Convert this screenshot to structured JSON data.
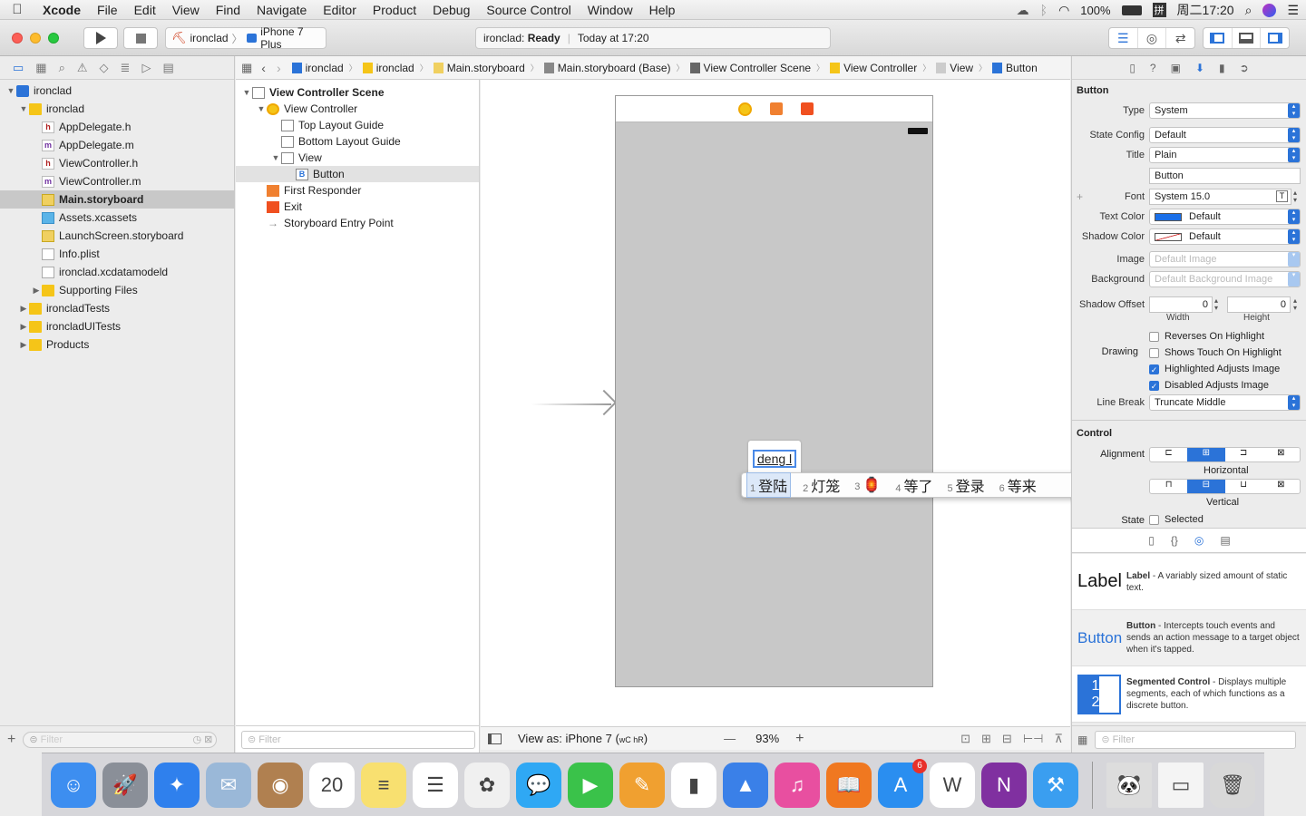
{
  "menubar": {
    "app": "Xcode",
    "items": [
      "File",
      "Edit",
      "View",
      "Find",
      "Navigate",
      "Editor",
      "Product",
      "Debug",
      "Source Control",
      "Window",
      "Help"
    ],
    "battery": "100%",
    "clock": "周二17:20"
  },
  "toolbar": {
    "scheme": "ironclad",
    "device": "iPhone 7 Plus",
    "status_project": "ironclad:",
    "status_state": "Ready",
    "status_time": "Today at 17:20"
  },
  "navigator": {
    "filter_placeholder": "Filter",
    "tree": [
      {
        "label": "ironclad",
        "depth": 0,
        "icon": "project-icon",
        "disclosure": "open"
      },
      {
        "label": "ironclad",
        "depth": 1,
        "icon": "folder-icon",
        "disclosure": "open"
      },
      {
        "label": "AppDelegate.h",
        "depth": 2,
        "icon": "header-file-icon",
        "disclosure": ""
      },
      {
        "label": "AppDelegate.m",
        "depth": 2,
        "icon": "implementation-file-icon",
        "disclosure": ""
      },
      {
        "label": "ViewController.h",
        "depth": 2,
        "icon": "header-file-icon",
        "disclosure": ""
      },
      {
        "label": "ViewController.m",
        "depth": 2,
        "icon": "implementation-file-icon",
        "disclosure": ""
      },
      {
        "label": "Main.storyboard",
        "depth": 2,
        "icon": "storyboard-file-icon",
        "disclosure": "",
        "selected": true
      },
      {
        "label": "Assets.xcassets",
        "depth": 2,
        "icon": "asset-catalog-icon",
        "disclosure": ""
      },
      {
        "label": "LaunchScreen.storyboard",
        "depth": 2,
        "icon": "storyboard-file-icon",
        "disclosure": ""
      },
      {
        "label": "Info.plist",
        "depth": 2,
        "icon": "plist-file-icon",
        "disclosure": ""
      },
      {
        "label": "ironclad.xcdatamodeld",
        "depth": 2,
        "icon": "datamodel-file-icon",
        "disclosure": ""
      },
      {
        "label": "Supporting Files",
        "depth": 2,
        "icon": "folder-icon",
        "disclosure": "closed"
      },
      {
        "label": "ironcladTests",
        "depth": 1,
        "icon": "folder-icon",
        "disclosure": "closed"
      },
      {
        "label": "ironcladUITests",
        "depth": 1,
        "icon": "folder-icon",
        "disclosure": "closed"
      },
      {
        "label": "Products",
        "depth": 1,
        "icon": "folder-icon",
        "disclosure": "closed"
      }
    ]
  },
  "jumpbar": {
    "crumbs": [
      "ironclad",
      "ironclad",
      "Main.storyboard",
      "Main.storyboard (Base)",
      "View Controller Scene",
      "View Controller",
      "View",
      "Button"
    ]
  },
  "outline": {
    "filter_placeholder": "Filter",
    "rows": [
      {
        "label": "View Controller Scene",
        "depth": 0,
        "disclosure": "open",
        "bold": true
      },
      {
        "label": "View Controller",
        "depth": 1,
        "disclosure": "open"
      },
      {
        "label": "Top Layout Guide",
        "depth": 2,
        "disclosure": ""
      },
      {
        "label": "Bottom Layout Guide",
        "depth": 2,
        "disclosure": ""
      },
      {
        "label": "View",
        "depth": 2,
        "disclosure": "open"
      },
      {
        "label": "Button",
        "depth": 3,
        "disclosure": "",
        "selected": true
      },
      {
        "label": "First Responder",
        "depth": 1,
        "disclosure": ""
      },
      {
        "label": "Exit",
        "depth": 1,
        "disclosure": ""
      },
      {
        "label": "Storyboard Entry Point",
        "depth": 1,
        "disclosure": ""
      }
    ]
  },
  "canvas": {
    "button_text": "deng l",
    "view_as": "View as: iPhone 7 (",
    "size_class": "wC hR",
    "view_as_end": ")",
    "zoom": "93%",
    "minus": "—",
    "plus": "+"
  },
  "ime": {
    "candidates": [
      {
        "num": "1",
        "text": "登陆"
      },
      {
        "num": "2",
        "text": "灯笼"
      },
      {
        "num": "3",
        "text": "🏮"
      },
      {
        "num": "4",
        "text": "等了"
      },
      {
        "num": "5",
        "text": "登录"
      },
      {
        "num": "6",
        "text": "等来"
      }
    ]
  },
  "inspector": {
    "section_button": "Button",
    "type_label": "Type",
    "type_value": "System",
    "state_label": "State Config",
    "state_value": "Default",
    "title_label": "Title",
    "title_value": "Plain",
    "title_text": "Button",
    "font_label": "Font",
    "font_value": "System 15.0",
    "textcolor_label": "Text Color",
    "textcolor_value": "Default",
    "shadowcolor_label": "Shadow Color",
    "shadowcolor_value": "Default",
    "image_label": "Image",
    "image_placeholder": "Default Image",
    "background_label": "Background",
    "background_placeholder": "Default Background Image",
    "shadowoffset_label": "Shadow Offset",
    "width_value": "0",
    "height_value": "0",
    "width_label": "Width",
    "height_label": "Height",
    "drawing_label": "Drawing",
    "checks": [
      {
        "label": "Reverses On Highlight",
        "checked": false
      },
      {
        "label": "Shows Touch On Highlight",
        "checked": false
      },
      {
        "label": "Highlighted Adjusts Image",
        "checked": true
      },
      {
        "label": "Disabled Adjusts Image",
        "checked": true
      }
    ],
    "linebreak_label": "Line Break",
    "linebreak_value": "Truncate Middle",
    "section_control": "Control",
    "alignment_label": "Alignment",
    "horizontal_label": "Horizontal",
    "vertical_label": "Vertical",
    "state_row_label": "State",
    "selected_label": "Selected",
    "library": [
      {
        "icon_text": "Label",
        "title": "Label",
        "desc": " - A variably sized amount of static text."
      },
      {
        "icon_text": "Button",
        "title": "Button",
        "desc": " - Intercepts touch events and sends an action message to a target object when it's tapped."
      },
      {
        "icon_text": "1 2",
        "title": "Segmented Control",
        "desc": " - Displays multiple segments, each of which functions as a discrete button."
      }
    ],
    "filter_placeholder": "Filter"
  },
  "dock": {
    "items": [
      {
        "name": "finder-icon",
        "color": "#3d8ef0",
        "glyph": "☺"
      },
      {
        "name": "launchpad-icon",
        "color": "#8a8f98",
        "glyph": "🚀"
      },
      {
        "name": "safari-icon",
        "color": "#2f80ed",
        "glyph": "✦"
      },
      {
        "name": "mail-icon",
        "color": "#9ab8d8",
        "glyph": "✉"
      },
      {
        "name": "contacts-icon",
        "color": "#b08050",
        "glyph": "◉"
      },
      {
        "name": "calendar-icon",
        "color": "#ffffff",
        "glyph": "20"
      },
      {
        "name": "notes-icon",
        "color": "#f8e070",
        "glyph": "≡"
      },
      {
        "name": "reminders-icon",
        "color": "#ffffff",
        "glyph": "☰"
      },
      {
        "name": "photos-icon",
        "color": "#f0f0f0",
        "glyph": "✿"
      },
      {
        "name": "messages-icon",
        "color": "#2fa8f4",
        "glyph": "💬"
      },
      {
        "name": "facetime-icon",
        "color": "#3ac24a",
        "glyph": "▶"
      },
      {
        "name": "pages-icon",
        "color": "#f0a030",
        "glyph": "✎"
      },
      {
        "name": "numbers-icon",
        "color": "#ffffff",
        "glyph": "▮"
      },
      {
        "name": "keynote-icon",
        "color": "#3a80e8",
        "glyph": "▲"
      },
      {
        "name": "itunes-icon",
        "color": "#e84fa0",
        "glyph": "♫"
      },
      {
        "name": "ibooks-icon",
        "color": "#f07820",
        "glyph": "📖"
      },
      {
        "name": "appstore-icon",
        "color": "#2a8ef0",
        "glyph": "A",
        "badge": "6"
      },
      {
        "name": "wunderlist-icon",
        "color": "#ffffff",
        "glyph": "W"
      },
      {
        "name": "onenote-icon",
        "color": "#8030a0",
        "glyph": "N"
      },
      {
        "name": "xcode-icon",
        "color": "#3a9ef0",
        "glyph": "⚒"
      },
      {
        "name": "panda-image-icon",
        "color": "#dddddd",
        "glyph": "🐼"
      },
      {
        "name": "onenote-window-icon",
        "color": "#f4f4f4",
        "glyph": "▭"
      },
      {
        "name": "trash-icon",
        "color": "#d8d8d8",
        "glyph": "🗑"
      }
    ]
  }
}
